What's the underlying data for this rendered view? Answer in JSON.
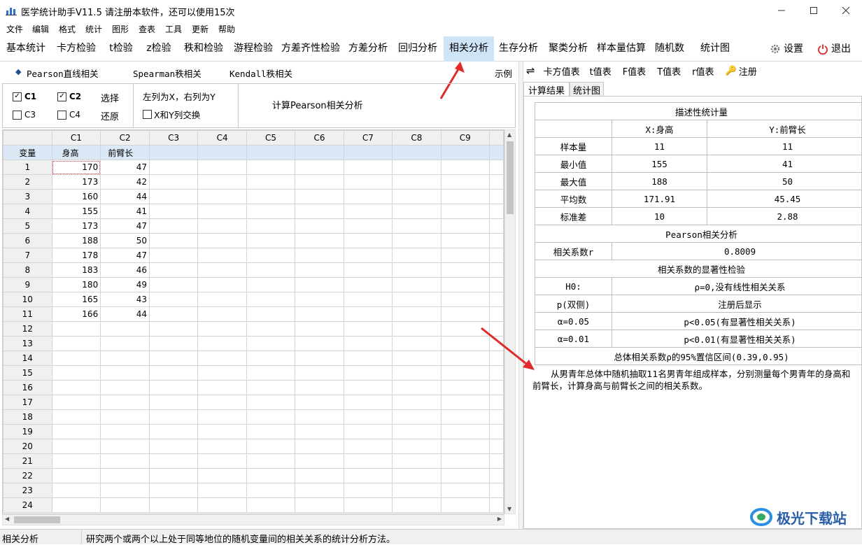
{
  "window": {
    "title": "医学统计助手V11.5",
    "notice": "请注册本软件，还可以使用15次"
  },
  "menu": [
    "文件",
    "编辑",
    "格式",
    "统计",
    "图形",
    "查表",
    "工具",
    "更新",
    "帮助"
  ],
  "toolbar": {
    "tabs": [
      "基本统计",
      "卡方检验",
      "t检验",
      "z检验",
      "秩和检验",
      "游程检验",
      "方差齐性检验",
      "方差分析",
      "回归分析",
      "相关分析",
      "生存分析",
      "聚类分析",
      "样本量估算",
      "随机数",
      "统计图"
    ],
    "active_tab": "相关分析",
    "settings_label": "设置",
    "exit_label": "退出"
  },
  "subtabs": {
    "pearson": "Pearson直线相关",
    "spearman": "Spearman秩相关",
    "kendall": "Kendall秩相关",
    "example": "示例"
  },
  "options": {
    "checks": [
      {
        "label": "C1",
        "checked": true
      },
      {
        "label": "C2",
        "checked": true
      },
      {
        "label": "C3",
        "checked": false
      },
      {
        "label": "C4",
        "checked": false
      }
    ],
    "select_label": "选择",
    "restore_label": "还原",
    "xy_note": "左列为X，右列为Y",
    "swap_label": "X和Y列交换",
    "calc_label": "计算Pearson相关分析"
  },
  "grid": {
    "col_headers": [
      "C1",
      "C2",
      "C3",
      "C4",
      "C5",
      "C6",
      "C7",
      "C8",
      "C9"
    ],
    "var_label": "变量",
    "var_names": [
      "身高",
      "前臂长"
    ],
    "rows": [
      [
        "1",
        "170",
        "47"
      ],
      [
        "2",
        "173",
        "42"
      ],
      [
        "3",
        "160",
        "44"
      ],
      [
        "4",
        "155",
        "41"
      ],
      [
        "5",
        "173",
        "47"
      ],
      [
        "6",
        "188",
        "50"
      ],
      [
        "7",
        "178",
        "47"
      ],
      [
        "8",
        "183",
        "46"
      ],
      [
        "9",
        "180",
        "49"
      ],
      [
        "10",
        "165",
        "43"
      ],
      [
        "11",
        "166",
        "44"
      ],
      [
        "12",
        "",
        ""
      ],
      [
        "13",
        "",
        ""
      ],
      [
        "14",
        "",
        ""
      ],
      [
        "15",
        "",
        ""
      ],
      [
        "16",
        "",
        ""
      ],
      [
        "17",
        "",
        ""
      ],
      [
        "18",
        "",
        ""
      ],
      [
        "19",
        "",
        ""
      ],
      [
        "20",
        "",
        ""
      ],
      [
        "21",
        "",
        ""
      ],
      [
        "22",
        "",
        ""
      ],
      [
        "23",
        "",
        ""
      ],
      [
        "24",
        "",
        ""
      ]
    ]
  },
  "right_toolbar": {
    "items": [
      "卡方值表",
      "t值表",
      "F值表",
      "T值表",
      "r值表"
    ],
    "register": "注册"
  },
  "result_tabs": [
    "计算结果",
    "统计图"
  ],
  "results": {
    "desc_title": "描述性统计量",
    "col_x": "X:身高",
    "col_y": "Y:前臂长",
    "stats": [
      [
        "样本量",
        "11",
        "11"
      ],
      [
        "最小值",
        "155",
        "41"
      ],
      [
        "最大值",
        "188",
        "50"
      ],
      [
        "平均数",
        "171.91",
        "45.45"
      ],
      [
        "标准差",
        "10",
        "2.88"
      ]
    ],
    "pearson_title": "Pearson相关分析",
    "r_label": "相关系数r",
    "r_value": "0.8009",
    "sig_title": "相关系数的显著性检验",
    "tests": [
      [
        "H0:",
        "ρ=0,没有线性相关关系"
      ],
      [
        "p(双侧)",
        "注册后显示"
      ],
      [
        "α=0.05",
        "p<0.05(有显著性相关关系)"
      ],
      [
        "α=0.01",
        "p<0.01(有显著性相关关系)"
      ]
    ],
    "ci": "总体相关系数ρ的95%置信区间(0.39,0.95)"
  },
  "description": "从男青年总体中随机抽取11名男青年组成样本，分别测量每个男青年的身高和前臂长，计算身高与前臂长之间的相关系数。",
  "status": {
    "left": "相关分析",
    "right": "研究两个或两个以上处于同等地位的随机变量间的相关关系的统计分析方法。"
  },
  "watermark": "极光下载站"
}
